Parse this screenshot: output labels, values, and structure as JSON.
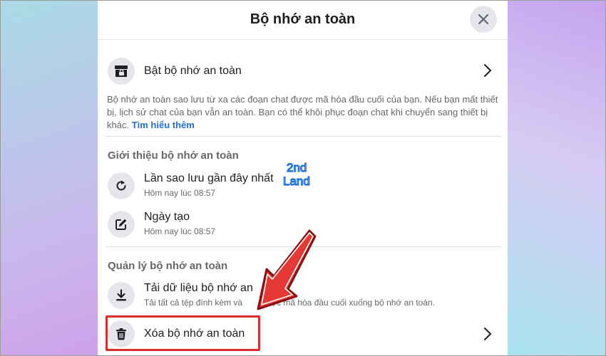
{
  "dialog": {
    "title": "Bộ nhớ an toàn"
  },
  "enable_row": {
    "label": "Bật bộ nhớ an toàn",
    "icon": "lock-archive-icon"
  },
  "description": {
    "text": "Bộ nhớ an toàn sao lưu từ xa các đoạn chat được mã hóa đầu cuối của bạn. Nếu bạn mất thiết bị, lịch sử chat của bạn vẫn an toàn. Bạn có thể khôi phục đoạn chat khi chuyển sang thiết bị khác.",
    "link": "Tìm hiểu thêm"
  },
  "about_section": {
    "title": "Giới thiệu bộ nhớ an toàn",
    "items": [
      {
        "label": "Lần sao lưu gần đây nhất",
        "sub": "Hôm nay lúc 08:57",
        "icon": "refresh-icon"
      },
      {
        "label": "Ngày tạo",
        "sub": "Hôm nay lúc 08:57",
        "icon": "edit-icon"
      }
    ]
  },
  "manage_section": {
    "title": "Quản lý bộ nhớ an toàn",
    "download": {
      "label": "Tải dữ liệu bộ nhớ an",
      "sub": "Tải tất cả tệp đính kèm và",
      "sub_rest": "được mã hóa đầu cuối xuống bộ nhớ an toàn.",
      "icon": "download-icon"
    },
    "delete": {
      "label": "Xóa bộ nhớ an toàn",
      "icon": "trash-icon"
    }
  },
  "watermark": {
    "line1": "2nd",
    "line2": "Land"
  },
  "colors": {
    "accent_link": "#216fdb",
    "highlight": "#d92b2b"
  }
}
